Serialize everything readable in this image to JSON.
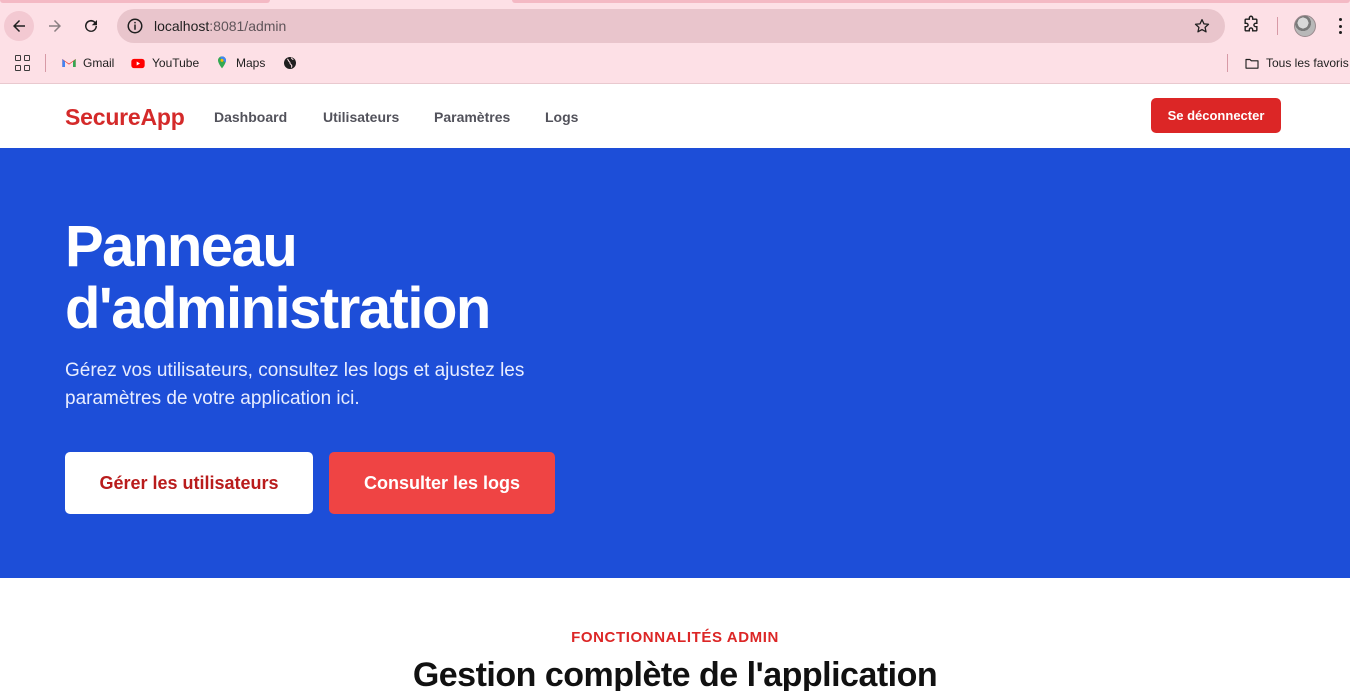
{
  "browser": {
    "url_host": "localhost",
    "url_path": ":8081/admin",
    "bookmarks": [
      {
        "label": "Gmail",
        "icon": "gmail-icon"
      },
      {
        "label": "YouTube",
        "icon": "youtube-icon"
      },
      {
        "label": "Maps",
        "icon": "maps-icon"
      }
    ],
    "all_bookmarks_label": "Tous les favoris",
    "colors": {
      "chrome_bg": "#fde0e6",
      "omnibox_bg": "#e9c5cc"
    }
  },
  "app": {
    "brand": "SecureApp",
    "nav": [
      "Dashboard",
      "Utilisateurs",
      "Paramètres",
      "Logs"
    ],
    "logout_label": "Se déconnecter",
    "colors": {
      "brand": "#d42a2a",
      "hero_bg": "#1d4ed8",
      "logout_bg": "#dc2626",
      "secondary_cta": "#ef4444"
    }
  },
  "hero": {
    "title_line1": "Panneau",
    "title_line2": "d'administration",
    "subtitle": "Gérez vos utilisateurs, consultez les logs et ajustez les paramètres de votre application ici.",
    "primary_cta": "Gérer les utilisateurs",
    "secondary_cta": "Consulter les logs"
  },
  "features": {
    "eyebrow": "FONCTIONNALITÉS ADMIN",
    "title": "Gestion complète de l'application"
  }
}
